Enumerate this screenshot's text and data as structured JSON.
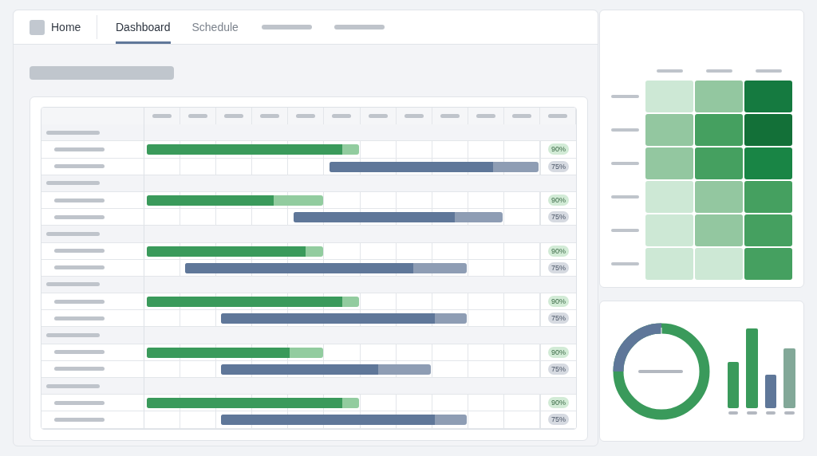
{
  "nav": {
    "home": {
      "label": "Home"
    },
    "tabs": [
      {
        "label": "Dashboard",
        "selected": true
      },
      {
        "label": "Schedule",
        "selected": false
      }
    ]
  },
  "gantt": {
    "groups": [
      {
        "tasks": [
          {
            "kind": "green",
            "level": 0.92,
            "badge": "90%"
          },
          {
            "kind": "blue",
            "level": 0.78,
            "badge": "75%"
          }
        ]
      },
      {
        "tasks": [
          {
            "kind": "green",
            "level": 0.72,
            "badge": "90%"
          },
          {
            "kind": "blue",
            "level": 0.77,
            "badge": "75%"
          }
        ]
      },
      {
        "tasks": [
          {
            "kind": "green",
            "level": 0.9,
            "badge": "90%"
          },
          {
            "kind": "blue",
            "level": 0.81,
            "badge": "75%"
          }
        ]
      },
      {
        "tasks": [
          {
            "kind": "green",
            "level": 0.92,
            "badge": "90%"
          },
          {
            "kind": "blue",
            "level": 0.87,
            "badge": "75%"
          }
        ]
      },
      {
        "tasks": [
          {
            "kind": "green",
            "level": 0.81,
            "badge": "90%"
          },
          {
            "kind": "blue",
            "level": 0.75,
            "badge": "75%"
          }
        ]
      },
      {
        "tasks": [
          {
            "kind": "green",
            "level": 0.92,
            "badge": "90%"
          },
          {
            "kind": "blue",
            "level": 0.87,
            "badge": "75%"
          }
        ]
      }
    ]
  },
  "heatmap": {
    "rows": [
      {
        "cells": [
          {
            "color": "#cde8d5"
          },
          {
            "color": "#93c7a0"
          },
          {
            "color": "#157a40"
          }
        ]
      },
      {
        "cells": [
          {
            "color": "#93c7a0"
          },
          {
            "color": "#45a060"
          },
          {
            "color": "#137038"
          }
        ]
      },
      {
        "cells": [
          {
            "color": "#93c7a0"
          },
          {
            "color": "#45a060"
          },
          {
            "color": "#198545"
          }
        ]
      },
      {
        "cells": [
          {
            "color": "#cde8d5"
          },
          {
            "color": "#93c7a0"
          },
          {
            "color": "#45a060"
          }
        ]
      },
      {
        "cells": [
          {
            "color": "#cde8d5"
          },
          {
            "color": "#93c7a0"
          },
          {
            "color": "#45a060"
          }
        ]
      },
      {
        "cells": [
          {
            "color": "#cde8d5"
          },
          {
            "color": "#cde8d5"
          },
          {
            "color": "#45a060"
          }
        ]
      }
    ]
  }
}
